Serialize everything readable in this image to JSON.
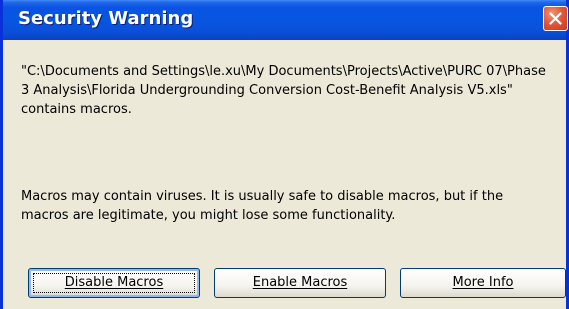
{
  "dialog": {
    "title": "Security Warning",
    "close_icon": "close-icon",
    "message_path": "\"C:\\Documents and Settings\\le.xu\\My Documents\\Projects\\Active\\PURC 07\\Phase 3 Analysis\\Florida Undergrounding Conversion Cost-Benefit Analysis V5.xls\" contains macros.",
    "message_warning": "Macros may contain viruses. It is usually safe to disable macros, but if the macros are legitimate, you might lose some functionality."
  },
  "buttons": {
    "disable_label": "Disable Macros",
    "enable_label": "Enable Macros",
    "more_info_label": "More Info"
  },
  "colors": {
    "titlebar": "#0756e0",
    "close": "#e2583a",
    "dialog_bg": "#ece9d8",
    "button_border": "#003c74"
  }
}
